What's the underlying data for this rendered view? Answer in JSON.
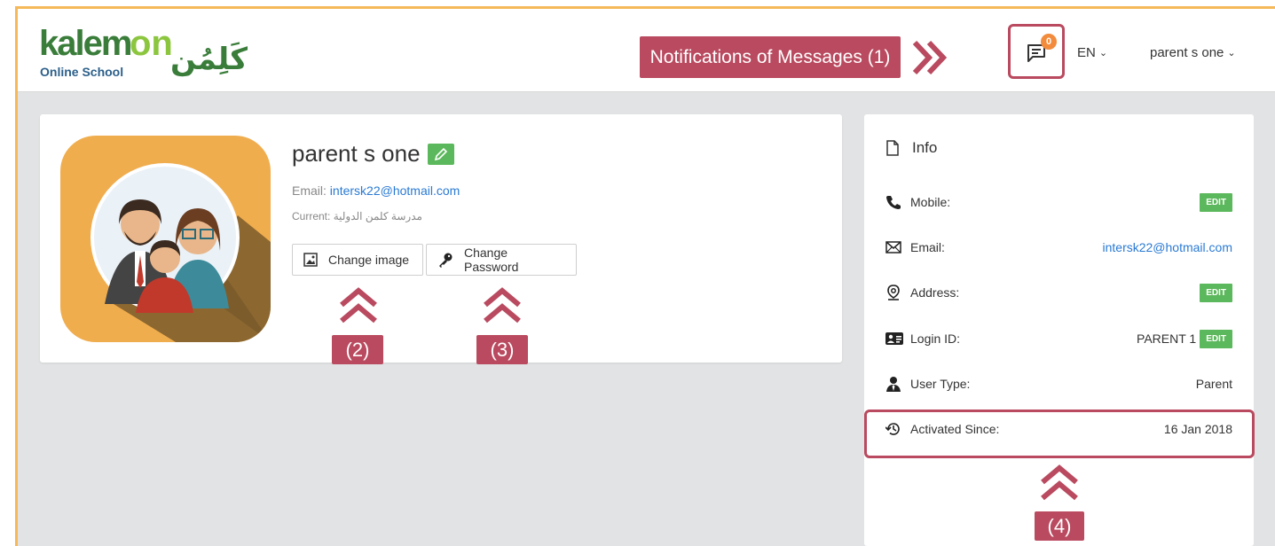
{
  "header": {
    "logo_text": "kalemon",
    "logo_subtext": "Online School",
    "logo_arabic": "كَلِمُن",
    "notifications_count": "0",
    "language": "EN",
    "user_name": "parent s one"
  },
  "callouts": {
    "c1": "Notifications of Messages (1)",
    "c2": "(2)",
    "c3": "(3)",
    "c4": "(4)"
  },
  "profile": {
    "name": "parent s one",
    "email_label": "Email:",
    "email": "intersk22@hotmail.com",
    "current": "Current: مدرسة كلمن الدولية",
    "change_image_label": "Change image",
    "change_password_label": "Change Password"
  },
  "info": {
    "title": "Info",
    "rows": [
      {
        "label": "Mobile:",
        "value": "",
        "edit": "EDIT"
      },
      {
        "label": "Email:",
        "value": "intersk22@hotmail.com",
        "edit": ""
      },
      {
        "label": "Address:",
        "value": "",
        "edit": "EDIT"
      },
      {
        "label": "Login ID:",
        "value": "PARENT 1",
        "edit": "EDIT"
      },
      {
        "label": "User Type:",
        "value": "Parent",
        "edit": ""
      },
      {
        "label": "Activated Since:",
        "value": "16 Jan 2018",
        "edit": ""
      }
    ]
  },
  "colors": {
    "accent_callout": "#b94a5f",
    "edit_green": "#5cb85c",
    "link_blue": "#2a7ad3",
    "badge_orange": "#f28b3c",
    "frame_orange": "#f5b95a"
  }
}
